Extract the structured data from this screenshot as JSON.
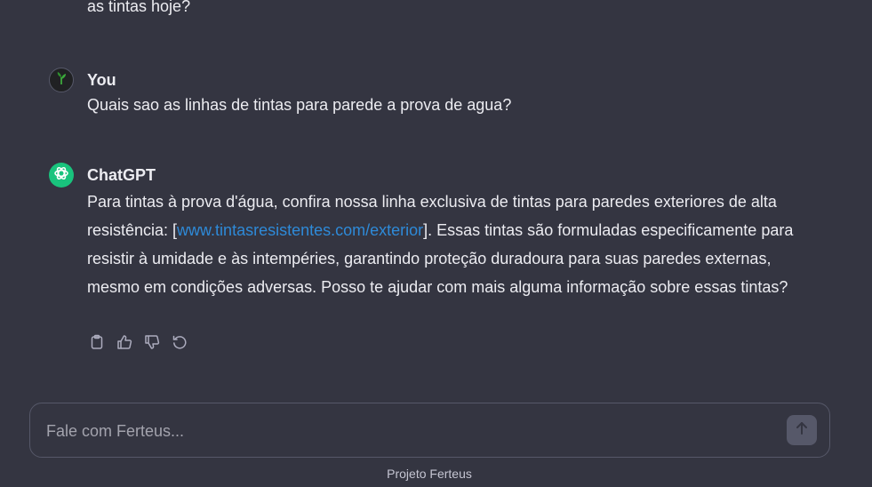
{
  "conversation": {
    "previous_tail": "as tintas hoje?",
    "user_message": {
      "author": "You",
      "avatar_icon": "plant-avatar-icon",
      "text": "Quais sao as linhas de tintas para parede a prova de agua?"
    },
    "assistant_message": {
      "author": "ChatGPT",
      "avatar_icon": "openai-logo-icon",
      "text_before_link": "Para tintas à prova d'água, confira nossa linha exclusiva de tintas para paredes exteriores de alta resistência: [",
      "link_text": "www.tintasresistentes.com/exterior",
      "text_after_link": "]. Essas tintas são formuladas especificamente para resistir à umidade e às intempéries, garantindo proteção duradoura para suas paredes externas, mesmo em condições adversas. Posso te ajudar com mais alguma informação sobre essas tintas?"
    },
    "actions": [
      "clipboard-icon",
      "thumbs-up-icon",
      "thumbs-down-icon",
      "regenerate-icon"
    ]
  },
  "composer": {
    "placeholder": "Fale com Ferteus...",
    "value": "",
    "send_icon": "arrow-up-icon"
  },
  "footer": {
    "text": "Projeto Ferteus"
  },
  "colors": {
    "background": "#343541",
    "text": "#ececf1",
    "link": "#2e8ad8",
    "assistant_avatar": "#19c37d",
    "border": "#565869"
  }
}
